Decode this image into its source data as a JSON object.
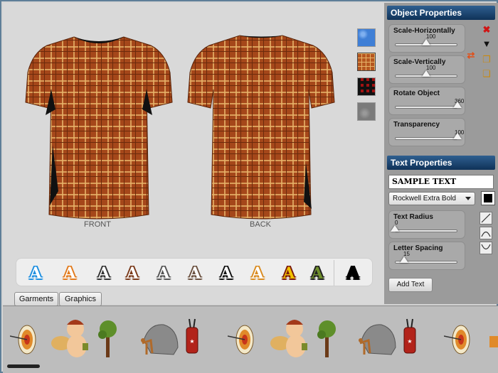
{
  "canvas": {
    "front_label": "FRONT",
    "back_label": "BACK",
    "swatches": [
      {
        "name": "blue-texture",
        "color": "#3f7fd6"
      },
      {
        "name": "orange-plaid",
        "color": "#b5561f"
      },
      {
        "name": "red-black-check",
        "color": "#a11212"
      },
      {
        "name": "gray-texture",
        "color": "#7b7b7b"
      }
    ]
  },
  "text_styles": {
    "glyph": "A",
    "items": [
      {
        "fill": "#ffffff",
        "stroke": "#1e8fe0"
      },
      {
        "fill": "#ffffff",
        "stroke": "#e27a1c"
      },
      {
        "fill": "#ffffff",
        "stroke": "#333333"
      },
      {
        "fill": "#ffffff",
        "stroke": "#7a3a1a"
      },
      {
        "fill": "#ffffff",
        "stroke": "#555555"
      },
      {
        "fill": "#ffffff",
        "stroke": "#6b5140"
      },
      {
        "fill": "#ffffff",
        "stroke": "#111111"
      },
      {
        "fill": "#ffffff",
        "stroke": "#d98b20"
      },
      {
        "fill": "#f2c200",
        "stroke": "#7a1a10"
      },
      {
        "fill": "#6f8f2c",
        "stroke": "#222222"
      },
      {
        "fill": "#000000",
        "stroke": "#000000"
      }
    ]
  },
  "tabs": {
    "garments": "Garments",
    "graphics": "Graphics"
  },
  "object_properties": {
    "title": "Object Properties",
    "scale_h": {
      "label": "Scale-Horizontally",
      "value": "100",
      "fraction": 0.5
    },
    "scale_v": {
      "label": "Scale-Vertically",
      "value": "100",
      "fraction": 0.5
    },
    "rotate": {
      "label": "Rotate Object",
      "value": "360",
      "fraction": 1.0
    },
    "transparency": {
      "label": "Transparency",
      "value": "100",
      "fraction": 1.0
    }
  },
  "text_properties": {
    "title": "Text Properties",
    "sample_text": "SAMPLE TEXT",
    "font": "Rockwell Extra Bold",
    "color": "#000000",
    "radius": {
      "label": "Text Radius",
      "value": "0",
      "fraction": 0.0
    },
    "spacing": {
      "label": "Letter Spacing",
      "value": "15",
      "fraction": 0.15
    },
    "add_text": "Add Text"
  },
  "colors": {
    "panel_header": "#1a416d",
    "plaid_base": "#a5471a",
    "plaid_line": "#e7b46a"
  }
}
